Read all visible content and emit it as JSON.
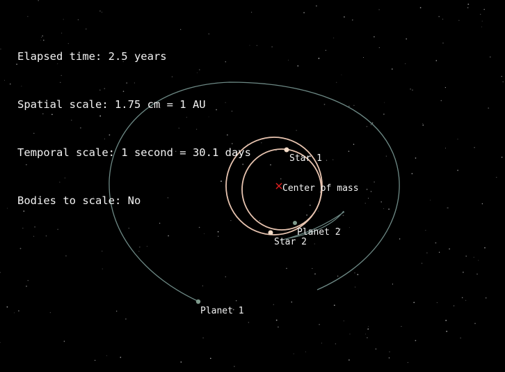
{
  "hud": {
    "elapsed_time": "Elapsed time: 2.5 years",
    "spatial_scale": "Spatial scale: 1.75 cm = 1 AU",
    "temporal_scale": "Temporal scale: 1 second = 30.1 days",
    "bodies_to_scale": "Bodies to scale: No"
  },
  "labels": {
    "star1": "Star 1",
    "star2": "Star 2",
    "planet1": "Planet 1",
    "planet2": "Planet 2",
    "center_of_mass": "Center of mass"
  },
  "colors": {
    "background": "#000000",
    "text": "#f2f2f2",
    "star_orbit": "#e8c4b0",
    "star_body": "#f4dcc8",
    "planet_orbit": "#6e8a86",
    "planet_body": "#7e9a8c",
    "center_marker": "#e02020"
  }
}
